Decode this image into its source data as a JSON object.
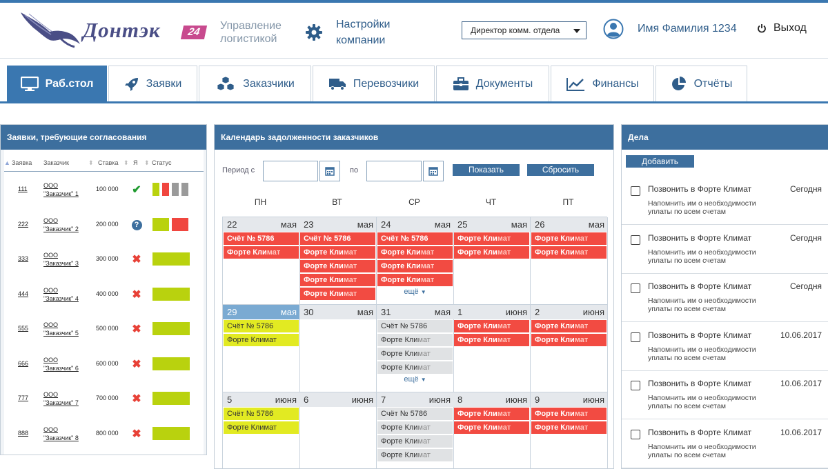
{
  "header": {
    "logo_text": "Донтэк",
    "logo_badge": "24",
    "subtitle_line1": "Управление",
    "subtitle_line2": "логистикой",
    "settings_line1": "Настройки",
    "settings_line2": "компании",
    "role_select": "Директор комм. отдела",
    "user_name": "Имя Фамилия 1234",
    "logout": "Выход"
  },
  "nav": {
    "tabs": [
      {
        "label": "Раб.стол",
        "icon": "monitor-icon",
        "active": true
      },
      {
        "label": "Заявки",
        "icon": "rocket-icon"
      },
      {
        "label": "Заказчики",
        "icon": "cubes-icon"
      },
      {
        "label": "Перевозчики",
        "icon": "truck-icon"
      },
      {
        "label": "Документы",
        "icon": "briefcase-icon"
      },
      {
        "label": "Финансы",
        "icon": "line-chart-icon"
      },
      {
        "label": "Отчёты",
        "icon": "pie-chart-icon"
      }
    ]
  },
  "approvals": {
    "title": "Заявки, требующие согласования",
    "columns": [
      "Заявка",
      "Заказчик",
      "Ставка",
      "Я",
      "Статус"
    ],
    "rows": [
      {
        "id": "111",
        "cust1": "ООО",
        "cust2": "\"Заказчик\" 1",
        "amount": "100 000",
        "mark": "check-icon",
        "status": [
          "#b9d20e",
          "#f0463f",
          "#9a9a9a",
          "#9a9a9a"
        ]
      },
      {
        "id": "222",
        "cust1": "ООО",
        "cust2": "\"Заказчик\" 2",
        "amount": "200 000",
        "mark": "question-icon",
        "status": [
          "#b9d20e",
          "#f0463f"
        ]
      },
      {
        "id": "333",
        "cust1": "ООО",
        "cust2": "\"Заказчик\" 3",
        "amount": "300 000",
        "mark": "cross-icon",
        "status": [
          "#b9d20e"
        ]
      },
      {
        "id": "444",
        "cust1": "ООО",
        "cust2": "\"Заказчик\" 4",
        "amount": "400 000",
        "mark": "cross-icon",
        "status": [
          "#b9d20e"
        ]
      },
      {
        "id": "555",
        "cust1": "ООО",
        "cust2": "\"Заказчик\" 5",
        "amount": "500 000",
        "mark": "cross-icon",
        "status": [
          "#b9d20e"
        ]
      },
      {
        "id": "666",
        "cust1": "ООО",
        "cust2": "\"Заказчик\" 6",
        "amount": "600 000",
        "mark": "cross-icon",
        "status": [
          "#b9d20e"
        ]
      },
      {
        "id": "777",
        "cust1": "ООО",
        "cust2": "\"Заказчик\" 7",
        "amount": "700 000",
        "mark": "cross-icon",
        "status": [
          "#b9d20e"
        ]
      },
      {
        "id": "888",
        "cust1": "ООО",
        "cust2": "\"Заказчик\" 8",
        "amount": "800 000",
        "mark": "cross-icon",
        "status": [
          "#b9d20e"
        ]
      }
    ]
  },
  "calendar": {
    "title": "Календарь задолженности заказчиков",
    "period_from_label": "Период с",
    "period_to_label": "по",
    "show_button": "Показать",
    "reset_button": "Сбросить",
    "more_label": "ещё",
    "weekdays": [
      "ПН",
      "ВТ",
      "СР",
      "ЧТ",
      "ПТ"
    ],
    "weeks": [
      [
        {
          "day": "22",
          "month": "мая",
          "events": [
            {
              "t": "Счёт № 5786",
              "c": "red"
            },
            {
              "t": "Форте Климат",
              "c": "red"
            }
          ]
        },
        {
          "day": "23",
          "month": "мая",
          "events": [
            {
              "t": "Счёт № 5786",
              "c": "red"
            },
            {
              "t": "Форте Климат",
              "c": "red"
            },
            {
              "t": "Форте Климат",
              "c": "red"
            },
            {
              "t": "Форте Климат",
              "c": "red"
            },
            {
              "t": "Форте Климат",
              "c": "red"
            }
          ]
        },
        {
          "day": "24",
          "month": "мая",
          "events": [
            {
              "t": "Счёт № 5786",
              "c": "red"
            },
            {
              "t": "Форте Климат",
              "c": "red"
            },
            {
              "t": "Форте Климат",
              "c": "red"
            },
            {
              "t": "Форте Климат",
              "c": "red"
            }
          ],
          "more": true
        },
        {
          "day": "25",
          "month": "мая",
          "events": [
            {
              "t": "Форте Климат",
              "c": "red"
            },
            {
              "t": "Форте Климат",
              "c": "red"
            }
          ]
        },
        {
          "day": "26",
          "month": "мая",
          "events": [
            {
              "t": "Форте Климат",
              "c": "red"
            },
            {
              "t": "Форте Климат",
              "c": "red"
            }
          ]
        }
      ],
      [
        {
          "day": "29",
          "month": "мая",
          "highlight": true,
          "events": [
            {
              "t": "Счёт № 5786",
              "c": "yel"
            },
            {
              "t": "Форте Климат",
              "c": "yel"
            }
          ]
        },
        {
          "day": "30",
          "month": "мая",
          "events": []
        },
        {
          "day": "31",
          "month": "мая",
          "events": [
            {
              "t": "Счёт № 5786",
              "c": "gry"
            },
            {
              "t": "Форте Климат",
              "c": "gry"
            },
            {
              "t": "Форте Климат",
              "c": "gry"
            },
            {
              "t": "Форте Климат",
              "c": "gry"
            }
          ],
          "more": true
        },
        {
          "day": "1",
          "month": "июня",
          "events": [
            {
              "t": "Форте Климат",
              "c": "red"
            },
            {
              "t": "Форте Климат",
              "c": "red"
            }
          ]
        },
        {
          "day": "2",
          "month": "июня",
          "events": [
            {
              "t": "Форте Климат",
              "c": "red"
            },
            {
              "t": "Форте Климат",
              "c": "red"
            }
          ]
        }
      ],
      [
        {
          "day": "5",
          "month": "июня",
          "events": [
            {
              "t": "Счёт № 5786",
              "c": "yel"
            },
            {
              "t": "Форте Климат",
              "c": "yel"
            }
          ]
        },
        {
          "day": "6",
          "month": "июня",
          "events": []
        },
        {
          "day": "7",
          "month": "июня",
          "events": [
            {
              "t": "Счёт № 5786",
              "c": "gry"
            },
            {
              "t": "Форте Климат",
              "c": "gry"
            },
            {
              "t": "Форте Климат",
              "c": "gry"
            },
            {
              "t": "Форте Климат",
              "c": "gry"
            }
          ]
        },
        {
          "day": "8",
          "month": "июня",
          "events": [
            {
              "t": "Форте Климат",
              "c": "red"
            },
            {
              "t": "Форте Климат",
              "c": "red"
            }
          ]
        },
        {
          "day": "9",
          "month": "июня",
          "events": [
            {
              "t": "Форте Климат",
              "c": "red"
            },
            {
              "t": "Форте Климат",
              "c": "red"
            }
          ]
        }
      ]
    ]
  },
  "tasks": {
    "title": "Дела",
    "add_button": "Добавить",
    "items": [
      {
        "title": "Позвонить в Форте Климат",
        "date": "Сегодня",
        "text": "Напомнить им о необходимости уплаты по всем счетам"
      },
      {
        "title": "Позвонить в Форте Климат",
        "date": "Сегодня",
        "text": "Напомнить им о необходимости уплаты по всем счетам"
      },
      {
        "title": "Позвонить в Форте Климат",
        "date": "Сегодня",
        "text": "Напомнить им о необходимости уплаты по всем счетам"
      },
      {
        "title": "Позвонить в Форте Климат",
        "date": "10.06.2017",
        "text": "Напомнить им о необходимости уплаты по всем счетам"
      },
      {
        "title": "Позвонить в Форте Климат",
        "date": "10.06.2017",
        "text": "Напомнить им о необходимости уплаты по всем счетам"
      },
      {
        "title": "Позвонить в Форте Климат",
        "date": "10.06.2017",
        "text": "Напомнить им о необходимости уплаты по всем счетам"
      }
    ]
  }
}
